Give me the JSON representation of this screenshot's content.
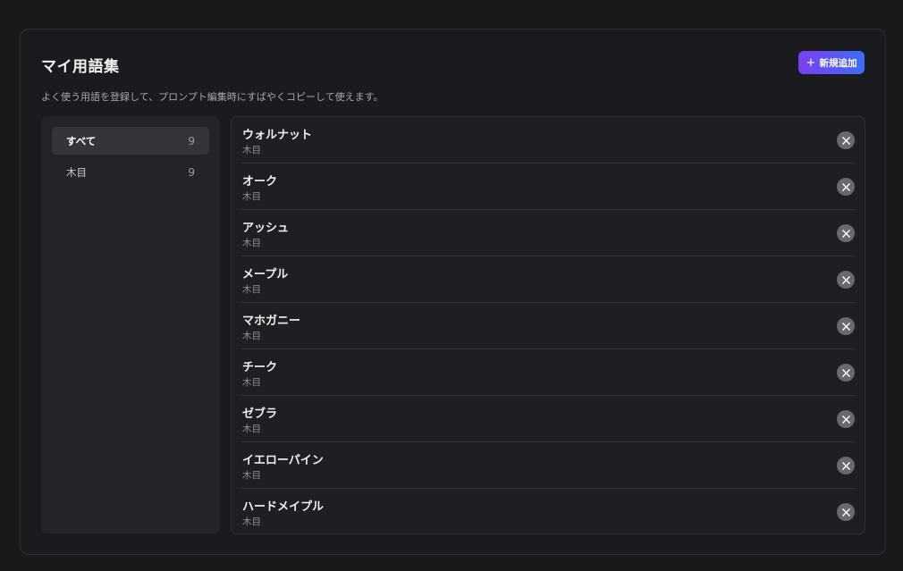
{
  "header": {
    "title": "マイ用語集",
    "description": "よく使う用語を登録して、プロンプト編集時にすばやくコピーして使えます。",
    "add_label": "新規追加"
  },
  "sidebar": {
    "categories": [
      {
        "label": "すべて",
        "count": "9",
        "active": true
      },
      {
        "label": "木目",
        "count": "9",
        "active": false
      }
    ]
  },
  "terms": [
    {
      "name": "ウォルナット",
      "category": "木目"
    },
    {
      "name": "オーク",
      "category": "木目"
    },
    {
      "name": "アッシュ",
      "category": "木目"
    },
    {
      "name": "メープル",
      "category": "木目"
    },
    {
      "name": "マホガニー",
      "category": "木目"
    },
    {
      "name": "チーク",
      "category": "木目"
    },
    {
      "name": "ゼブラ",
      "category": "木目"
    },
    {
      "name": "イエローパイン",
      "category": "木目"
    },
    {
      "name": "ハードメイプル",
      "category": "木目"
    }
  ],
  "icons": {
    "add": "plus-icon",
    "delete": "close-icon"
  },
  "colors": {
    "accent_start": "#7b3ff2",
    "accent_end": "#3c6cf5"
  }
}
